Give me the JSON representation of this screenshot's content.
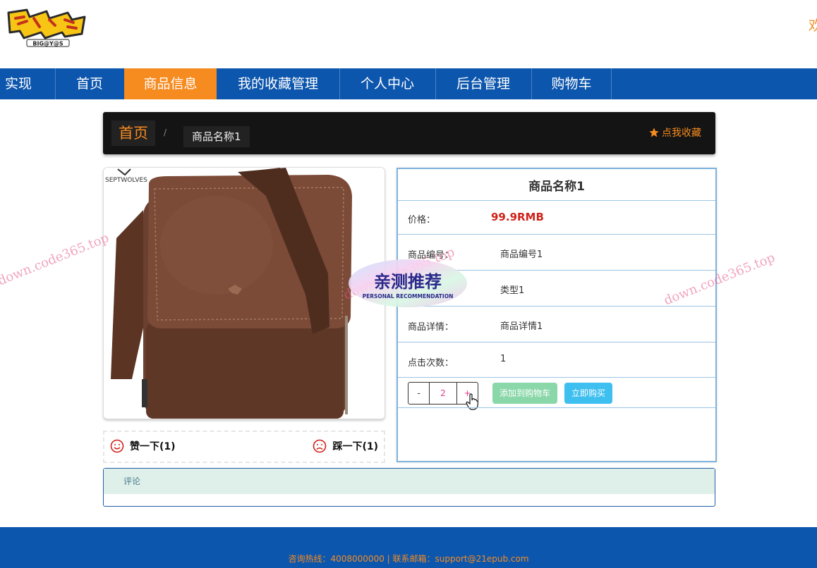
{
  "header": {
    "logo_text": "BIG@Y@S",
    "welcome_text": "欢"
  },
  "nav": {
    "items": [
      {
        "label": "实现"
      },
      {
        "label": "首页"
      },
      {
        "label": "商品信息"
      },
      {
        "label": "我的收藏管理"
      },
      {
        "label": "个人中心"
      },
      {
        "label": "后台管理"
      },
      {
        "label": "购物车"
      }
    ],
    "active": "商品信息"
  },
  "breadcrumb": {
    "home": "首页",
    "separator": "/",
    "current": "商品名称1",
    "favorite_label": "点我收藏"
  },
  "product_image": {
    "brand": "SEPTWOLVES"
  },
  "reactions": {
    "like_label": "赞一下(1)",
    "dislike_label": "踩一下(1)"
  },
  "detail": {
    "title": "商品名称1",
    "rows": [
      {
        "label": "价格：",
        "value": "99.9RMB"
      },
      {
        "label": "商品编号：",
        "value": "商品编号1"
      },
      {
        "label": "",
        "value": "类型1"
      },
      {
        "label": "商品详情：",
        "value": "商品详情1"
      },
      {
        "label": "点击次数：",
        "value": "1"
      }
    ],
    "quantity": {
      "minus": "-",
      "value": "2",
      "plus": "+"
    },
    "add_to_cart": "添加到购物车",
    "buy_now": "立即购买"
  },
  "comment": {
    "header": "评论"
  },
  "footer": {
    "text": "咨询热线：4008000000 | 联系邮箱：support@21epub.com"
  },
  "overlay": {
    "watermark": "down.code365.top",
    "sticker_title": "亲测推荐",
    "sticker_subtitle": "PERSONAL RECOMMENDATION"
  },
  "colors": {
    "nav_blue": "#0d56ad",
    "accent_orange": "#f68b1f",
    "price_red": "#d0221a",
    "panel_border": "#7fb3dc"
  }
}
